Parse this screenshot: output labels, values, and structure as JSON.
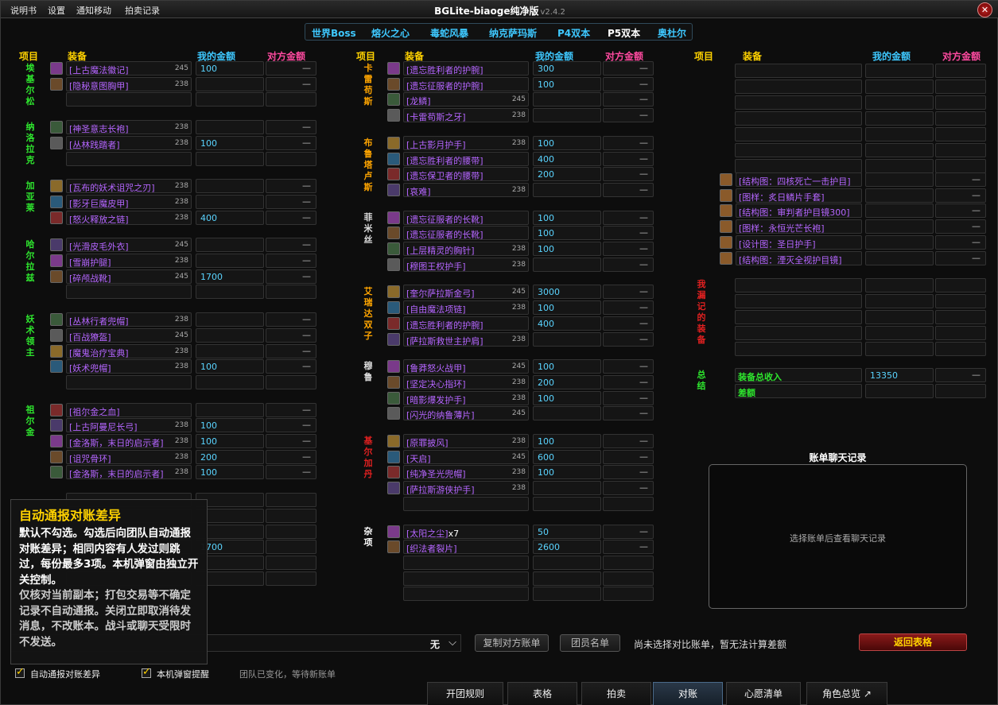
{
  "menu": [
    "说明书",
    "设置",
    "通知移动",
    "拍卖记录"
  ],
  "title": "BGLite-biaoge纯净版",
  "version": "v2.4.2",
  "raid_tabs": [
    "世界Boss",
    "熔火之心",
    "毒蛇风暴",
    "纳克萨玛斯",
    "P4双本",
    "P5双本",
    "奥杜尔"
  ],
  "headers": {
    "item": "项目",
    "equip": "装备",
    "my": "我的金额",
    "opp": "对方金额"
  },
  "dash": "—",
  "col1": [
    {
      "boss": "埃基尔松",
      "items": [
        [
          "上古魔法徽记",
          "245",
          "100"
        ],
        [
          "隐秘意图胸甲",
          "238",
          ""
        ],
        [
          "",
          "",
          ""
        ]
      ]
    },
    {
      "boss": "纳洛拉克",
      "items": [
        [
          "神圣意志长袍",
          "238",
          ""
        ],
        [
          "丛林践踏者",
          "238",
          "100"
        ],
        [
          "",
          "",
          ""
        ]
      ]
    },
    {
      "boss": "加亚莱",
      "items": [
        [
          "瓦布的妖术诅咒之刃",
          "238",
          ""
        ],
        [
          "影牙巨魔皮甲",
          "238",
          ""
        ],
        [
          "怒火释放之链",
          "238",
          "400"
        ]
      ]
    },
    {
      "boss": "哈尔拉兹",
      "items": [
        [
          "光滑皮毛外衣",
          "245",
          ""
        ],
        [
          "雪崩护腿",
          "238",
          ""
        ],
        [
          "碎颅战靴",
          "245",
          "1700"
        ],
        [
          "",
          "",
          ""
        ]
      ]
    },
    {
      "boss": "妖术领主",
      "items": [
        [
          "丛林行者兜帽",
          "238",
          ""
        ],
        [
          "百战獠盔",
          "245",
          ""
        ],
        [
          "魔鬼治疗宝典",
          "238",
          ""
        ],
        [
          "妖术兜帽",
          "238",
          "100"
        ],
        [
          "",
          "",
          ""
        ]
      ]
    },
    {
      "boss": "祖尔金",
      "items": [
        [
          "祖尔金之血",
          "",
          ""
        ],
        [
          "上古阿曼尼长弓",
          "238",
          "100"
        ],
        [
          "金洛斯，末日的启示者",
          "238",
          "100"
        ],
        [
          "诅咒骨环",
          "238",
          "200"
        ],
        [
          "金洛斯，末日的启示者",
          "238",
          "100"
        ]
      ]
    },
    {
      "boss": "",
      "items": [
        [
          "",
          "",
          ""
        ],
        [
          "",
          "",
          ""
        ],
        [
          "",
          "",
          ""
        ],
        [
          "",
          "",
          "1700"
        ],
        [
          "",
          "",
          ""
        ],
        [
          "",
          "",
          ""
        ]
      ]
    }
  ],
  "col2": [
    {
      "boss": "卡雷苟斯",
      "items": [
        [
          "遗忘胜利者的护腕",
          "",
          "300"
        ],
        [
          "遗忘征服者的护腕",
          "",
          "100"
        ],
        [
          "龙鳞",
          "245",
          ""
        ],
        [
          "卡雷苟斯之牙",
          "238",
          ""
        ]
      ]
    },
    {
      "boss": "布鲁塔卢斯",
      "items": [
        [
          "上古影月护手",
          "238",
          "100"
        ],
        [
          "遗忘胜利者的腰带",
          "",
          "400"
        ],
        [
          "遗忘保卫者的腰带",
          "",
          "200"
        ],
        [
          "哀难",
          "238",
          ""
        ]
      ]
    },
    {
      "boss": "菲米丝",
      "items": [
        [
          "遗忘征服者的长靴",
          "",
          "100"
        ],
        [
          "遗忘征服者的长靴",
          "",
          "100"
        ],
        [
          "上层精灵的胸针",
          "238",
          "100"
        ],
        [
          "穆图王权护手",
          "238",
          ""
        ]
      ]
    },
    {
      "boss": "艾瑞达双子",
      "items": [
        [
          "奎尔萨拉斯金弓",
          "245",
          "3000"
        ],
        [
          "自由魔法项链",
          "238",
          "100"
        ],
        [
          "遗忘胜利者的护腕",
          "",
          "400"
        ],
        [
          "萨拉斯救世主护肩",
          "238",
          ""
        ]
      ]
    },
    {
      "boss": "穆鲁",
      "items": [
        [
          "鲁莽怒火战甲",
          "245",
          "100"
        ],
        [
          "坚定决心指环",
          "238",
          "200"
        ],
        [
          "暗影爆发护手",
          "238",
          "100"
        ],
        [
          "闪光的纳鲁薄片",
          "245",
          ""
        ]
      ]
    },
    {
      "boss": "基尔加丹",
      "items": [
        [
          "原罪披风",
          "238",
          "100"
        ],
        [
          "天启",
          "245",
          "600"
        ],
        [
          "纯净圣光兜帽",
          "238",
          "100"
        ],
        [
          "萨拉斯游侠护手",
          "238",
          ""
        ],
        [
          "",
          "",
          ""
        ]
      ]
    },
    {
      "boss": "杂项",
      "items": [
        [
          "太阳之尘",
          "",
          "50",
          "x7"
        ],
        [
          "织法者裂片",
          "",
          "2600"
        ],
        [
          "",
          "",
          ""
        ],
        [
          "",
          "",
          ""
        ],
        [
          "",
          "",
          ""
        ]
      ]
    }
  ],
  "col3_blueprints": [
    "结构图：四核死亡一击护目",
    "图样：炙日鳞片手套",
    "结构图：审判者护目镜300",
    "图样：永恒光芒长袍",
    "设计图：圣日护手",
    "结构图：湮灭全视护目镜"
  ],
  "missed_label": "我漏记的装备",
  "summary_label": "总结",
  "summary": {
    "total_label": "装备总收入",
    "total_value": "13350",
    "diff_label": "差额"
  },
  "chat": {
    "title": "账单聊天记录",
    "hint": "选择账单后查看聊天记录"
  },
  "bottom": {
    "dropdown": "无",
    "copy_btn": "复制对方账单",
    "members_btn": "团员名单",
    "status": "尚未选择对比账单，暂无法计算差额",
    "return_btn": "返回表格",
    "cb1": "自动通报对账差异",
    "cb2": "本机弹窗提醒",
    "raid_status": "团队已变化，等待新账单"
  },
  "tooltip": {
    "title": "自动通报对账差异",
    "p1": "默认不勾选。勾选后向团队自动通报对账差异；相同内容有人发过则跳过，每份最多3项。本机弹窗由独立开关控制。",
    "p2": "仅核对当前副本；打包交易等不确定记录不自动通报。关闭立即取消待发消息，不改账本。战斗或聊天受限时不发送。"
  },
  "bottom_tabs": [
    "开团规则",
    "表格",
    "拍卖",
    "对账",
    "心愿清单",
    "角色总览 ↗"
  ]
}
